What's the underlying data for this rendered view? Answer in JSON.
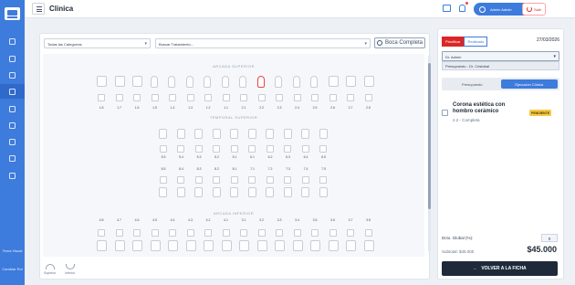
{
  "app": {
    "title": "Clinica"
  },
  "sidebar": {
    "bottom_items": [
      {
        "label": "Tema Visual"
      },
      {
        "label": "Cambiar Rol"
      }
    ]
  },
  "header": {
    "admin_label": "Admin Admin",
    "logout_label": "Salir"
  },
  "filters": {
    "category": "Todas las Categorías",
    "treatment": "Buscar Tratamiento...",
    "search_button": "Boca Completa"
  },
  "odontogram": {
    "upper_title": "ARCADA SUPERIOR",
    "temporal_title": "TEMPORAL SUPERIOR",
    "lower_title": "ARCADA INFERIOR",
    "upper_numbers": [
      "1.8",
      "1.7",
      "1.6",
      "1.5",
      "1.4",
      "1.3",
      "1.2",
      "1.1",
      "2.1",
      "2.2",
      "2.3",
      "2.4",
      "2.5",
      "2.6",
      "2.7",
      "2.8"
    ],
    "temp_upper_numbers": [
      "5.5",
      "5.4",
      "5.3",
      "5.2",
      "5.1",
      "6.1",
      "6.2",
      "6.3",
      "6.4",
      "6.5"
    ],
    "temp_lower_numbers": [
      "8.5",
      "8.4",
      "8.3",
      "8.2",
      "8.1",
      "7.1",
      "7.2",
      "7.3",
      "7.4",
      "7.5"
    ],
    "lower_numbers": [
      "4.8",
      "4.7",
      "4.6",
      "4.5",
      "4.4",
      "4.3",
      "4.2",
      "4.1",
      "3.1",
      "3.2",
      "3.3",
      "3.4",
      "3.5",
      "3.6",
      "3.7",
      "3.8"
    ],
    "legend": {
      "superior": "Superior",
      "inferior": "Inferior"
    }
  },
  "panel": {
    "toggle_plan": "Planificar",
    "toggle_done": "Realizado",
    "date": "27/03/2026",
    "doctor": "Dr. Admin",
    "budget": "Presupuesto - Dr. Cristobal",
    "tab_budget": "Presupuesto",
    "tab_exec": "Ejecución Clínica",
    "item": {
      "title": "Corona estética con hombro cerámico",
      "subtitle": "2.2 - Completa",
      "badge": "PENDIENTE"
    },
    "global_label": "Dcto. Global (%):",
    "global_value": "0",
    "subtotal": "Subtotal: $45.000",
    "total": "$45.000",
    "back_button": "VOLVER A LA FICHA"
  }
}
